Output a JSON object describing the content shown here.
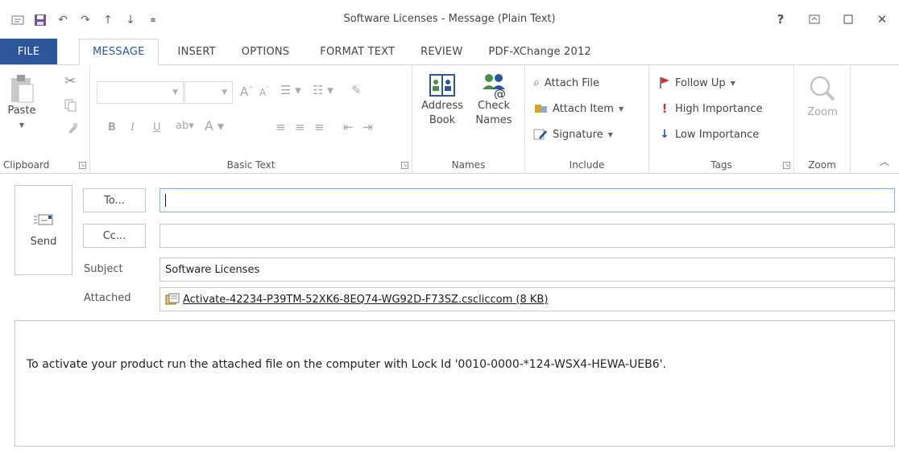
{
  "window": {
    "title": "Software Licenses - Message (Plain Text)",
    "help": "?"
  },
  "tabs": [
    "FILE",
    "MESSAGE",
    "INSERT",
    "OPTIONS",
    "FORMAT TEXT",
    "REVIEW",
    "PDF-XChange 2012"
  ],
  "ribbon": {
    "clipboard": {
      "paste": "Paste",
      "label": "Clipboard"
    },
    "basic_text": {
      "label": "Basic Text",
      "bold": "B",
      "italic": "I",
      "underline": "U",
      "font_color": "A"
    },
    "names": {
      "address_book": "Address\nBook",
      "address_book_l1": "Address",
      "address_book_l2": "Book",
      "check_names_l1": "Check",
      "check_names_l2": "Names",
      "label": "Names"
    },
    "include": {
      "attach_file": "Attach File",
      "attach_item": "Attach Item",
      "signature": "Signature",
      "label": "Include"
    },
    "tags": {
      "follow_up": "Follow Up",
      "high": "High Importance",
      "low": "Low Importance",
      "label": "Tags"
    },
    "zoom": {
      "button": "Zoom",
      "label": "Zoom"
    }
  },
  "compose": {
    "send": "Send",
    "to_button": "To...",
    "cc_button": "Cc...",
    "to_value": "",
    "cc_value": "",
    "subject_label": "Subject",
    "subject_value": "Software Licenses",
    "attached_label": "Attached",
    "attachment": "Activate-42234-P39TM-52XK6-8EQ74-WG92D-F73SZ.cscliccom (8 KB)",
    "body": "To activate your product run the attached file on the computer with Lock Id '0010-0000-*124-WSX4-HEWA-UEB6'."
  },
  "colors": {
    "accent": "#2b579a",
    "follow_up_flag": "#d13438",
    "high_importance": "#d13438",
    "low_importance": "#2b579a"
  }
}
